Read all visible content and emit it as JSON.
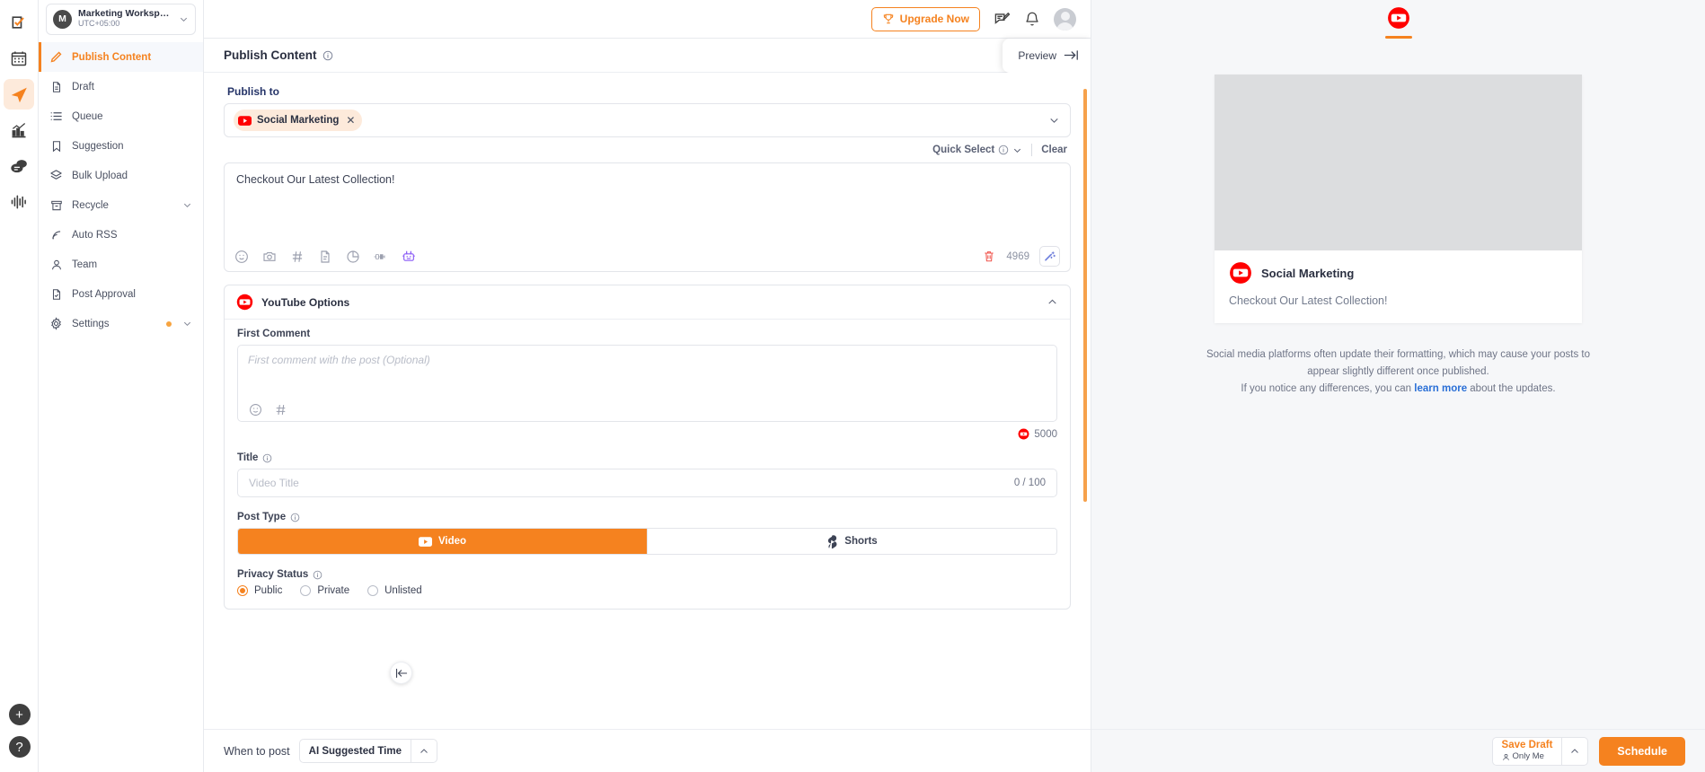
{
  "workspace": {
    "avatar_letter": "M",
    "name": "Marketing Workspa...",
    "timezone": "UTC+05:00"
  },
  "rail": {
    "items": [
      {
        "icon": "tasks-checkbox-icon",
        "active": false
      },
      {
        "icon": "calendar-icon",
        "active": false
      },
      {
        "icon": "paper-plane-icon",
        "active": true
      },
      {
        "icon": "analytics-bar-chart-icon",
        "active": false
      },
      {
        "icon": "inbox-chat-icon",
        "active": false
      },
      {
        "icon": "audio-waveform-icon",
        "active": false
      }
    ],
    "add_label": "+",
    "help_label": "?"
  },
  "sidebar": {
    "items": [
      {
        "label": "Publish Content",
        "icon": "pencil-icon",
        "active": true,
        "chevron": false,
        "dot": false
      },
      {
        "label": "Draft",
        "icon": "document-icon",
        "active": false,
        "chevron": false,
        "dot": false
      },
      {
        "label": "Queue",
        "icon": "list-icon",
        "active": false,
        "chevron": false,
        "dot": false
      },
      {
        "label": "Suggestion",
        "icon": "bookmark-icon",
        "active": false,
        "chevron": false,
        "dot": false
      },
      {
        "label": "Bulk Upload",
        "icon": "layers-icon",
        "active": false,
        "chevron": false,
        "dot": false
      },
      {
        "label": "Recycle",
        "icon": "archive-icon",
        "active": false,
        "chevron": true,
        "dot": false
      },
      {
        "label": "Auto RSS",
        "icon": "rss-icon",
        "active": false,
        "chevron": false,
        "dot": false
      },
      {
        "label": "Team",
        "icon": "user-icon",
        "active": false,
        "chevron": false,
        "dot": false
      },
      {
        "label": "Post Approval",
        "icon": "doc-check-icon",
        "active": false,
        "chevron": false,
        "dot": false
      },
      {
        "label": "Settings",
        "icon": "gear-icon",
        "active": false,
        "chevron": true,
        "dot": true
      }
    ]
  },
  "topbar": {
    "upgrade_label": "Upgrade Now",
    "upgrade_icon": "trophy-icon",
    "compose_icon": "compose-note-icon",
    "bell_icon": "bell-icon",
    "avatar_icon": "user-avatar-icon"
  },
  "page": {
    "title": "Publish Content",
    "title_info_icon": "info-circle-icon",
    "preview_label": "Preview",
    "preview_icon": "collapse-right-icon"
  },
  "publish_to": {
    "label": "Publish to",
    "chip": {
      "name": "Social Marketing",
      "platform_icon": "youtube-icon",
      "remove_icon": "close-icon"
    },
    "dropdown_icon": "chevron-down-icon",
    "quick_select_label": "Quick Select",
    "quick_select_info_icon": "info-circle-icon",
    "quick_select_chevron_icon": "chevron-down-icon",
    "clear_label": "Clear"
  },
  "composer": {
    "text": "Checkout Our Latest Collection!",
    "tools": [
      {
        "name": "emoji-icon"
      },
      {
        "name": "camera-icon"
      },
      {
        "name": "hashtag-icon"
      },
      {
        "name": "document-icon"
      },
      {
        "name": "pie-chart-icon"
      },
      {
        "name": "link-connector-icon"
      },
      {
        "name": "ai-robot-icon"
      }
    ],
    "delete_icon": "trash-icon",
    "char_count": "4969",
    "magic_icon": "magic-wand-icon"
  },
  "youtube_options": {
    "header": "YouTube Options",
    "header_icon": "youtube-icon",
    "collapse_icon": "chevron-up-icon",
    "first_comment": {
      "label": "First Comment",
      "placeholder": "First comment with the post (Optional)",
      "tools": [
        {
          "name": "emoji-icon"
        },
        {
          "name": "hashtag-icon"
        }
      ],
      "count": "5000",
      "count_icon": "youtube-icon"
    },
    "title": {
      "label": "Title",
      "info_icon": "info-circle-icon",
      "placeholder": "Video Title",
      "counter": "0 / 100"
    },
    "post_type": {
      "label": "Post Type",
      "info_icon": "info-circle-icon",
      "options": [
        {
          "label": "Video",
          "icon": "youtube-play-icon",
          "active": true
        },
        {
          "label": "Shorts",
          "icon": "shorts-icon",
          "active": false
        }
      ]
    },
    "privacy_status": {
      "label": "Privacy Status",
      "info_icon": "info-circle-icon",
      "options": [
        {
          "label": "Public",
          "selected": true
        },
        {
          "label": "Private",
          "selected": false
        },
        {
          "label": "Unlisted",
          "selected": false
        }
      ]
    }
  },
  "bottom": {
    "when_label": "When to post",
    "when_value": "AI Suggested Time",
    "when_chevron_icon": "chevron-up-icon",
    "save_draft_label": "Save Draft",
    "save_draft_sub": "Only Me",
    "save_draft_sub_icon": "person-lock-icon",
    "save_draft_chevron_icon": "chevron-up-icon",
    "schedule_label": "Schedule"
  },
  "preview": {
    "tab_icon": "youtube-icon",
    "account_name": "Social Marketing",
    "account_icon": "youtube-icon",
    "post_text": "Checkout Our Latest Collection!",
    "note_line1": "Social media platforms often update their formatting, which may cause your",
    "note_line2": "posts to appear slightly different once published.",
    "note_line3_pre": "If you notice any differences, you can ",
    "note_link": "learn more",
    "note_line3_post": " about the updates."
  },
  "collapse_handle_icon": "collapse-left-icon",
  "colors": {
    "accent": "#f5821f",
    "youtube_red": "#ff0000",
    "link_blue": "#2a6fd6",
    "heading_navy": "#253468"
  }
}
